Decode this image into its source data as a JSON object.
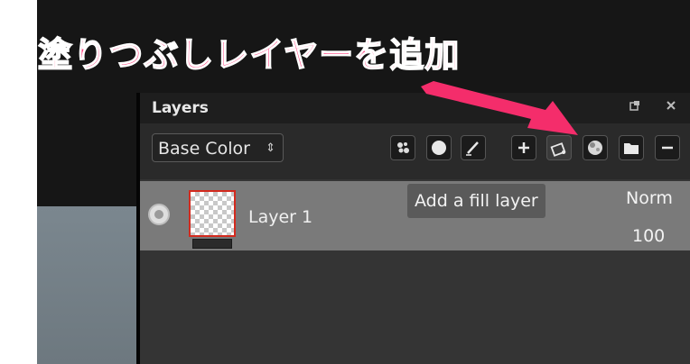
{
  "annotation": {
    "banner_text": "塗りつぶしレイヤーを追加",
    "banner_color": "#ff3a7c",
    "arrow_color": "#f42d6b"
  },
  "panel": {
    "title": "Layers",
    "header_icons": [
      "undock-icon",
      "close-icon"
    ]
  },
  "toolbar": {
    "channel_select": {
      "value": "Base Color",
      "arrow": "⇕"
    },
    "buttons": [
      "mask-generator-icon",
      "circle-icon",
      "brush-icon",
      "plus-icon",
      "fill-layer-icon",
      "ball-icon",
      "folder-icon",
      "minus-icon"
    ]
  },
  "layers": [
    {
      "name": "Layer 1",
      "blend_mode": "Norm",
      "opacity": "100",
      "visible": true
    }
  ],
  "tooltip": {
    "text": "Add a fill layer"
  }
}
